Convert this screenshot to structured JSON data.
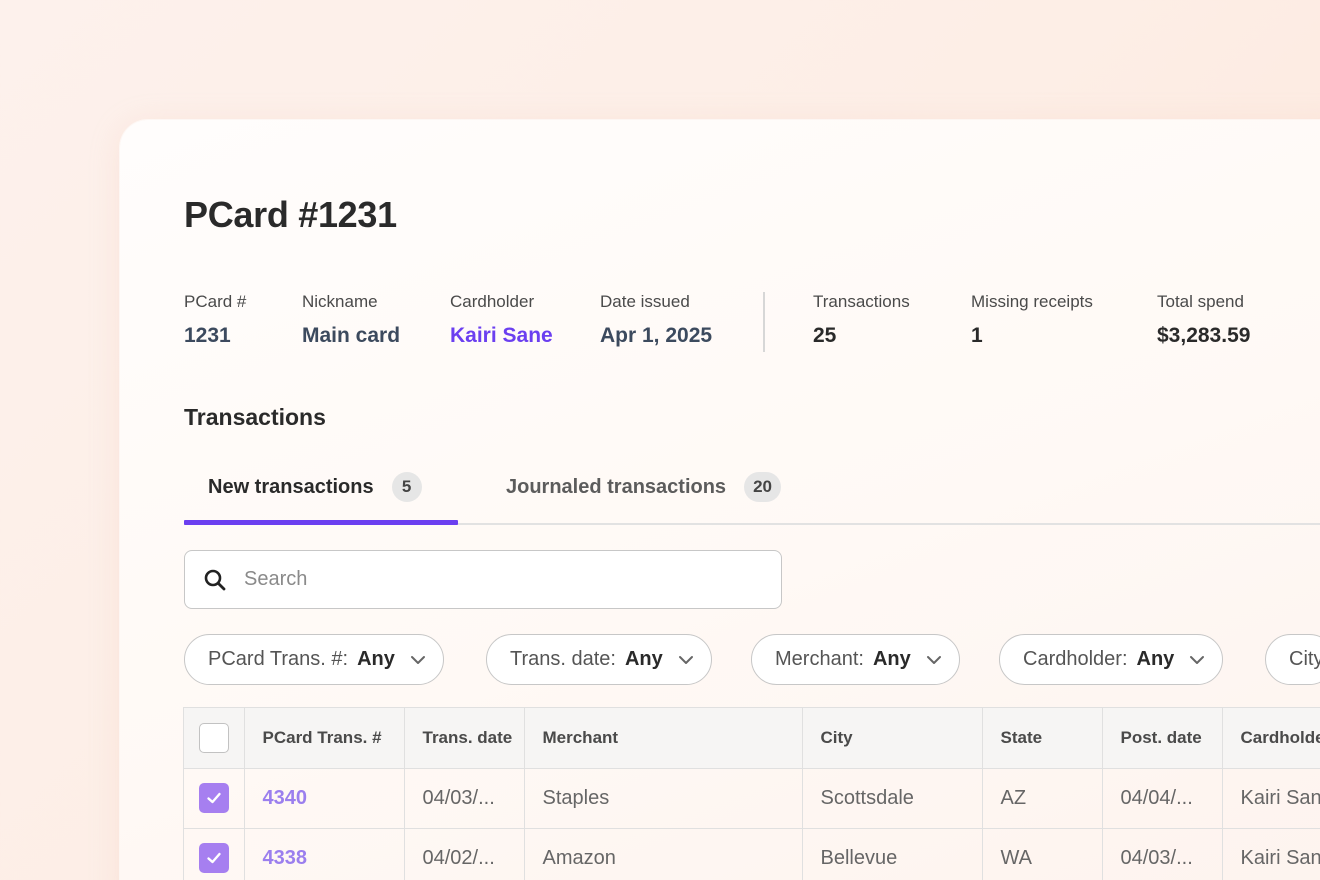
{
  "page": {
    "title": "PCard #1231"
  },
  "meta": [
    {
      "label": "PCard #",
      "value": "1231"
    },
    {
      "label": "Nickname",
      "value": "Main card"
    },
    {
      "label": "Cardholder",
      "value": "Kairi Sane"
    },
    {
      "label": "Date issued",
      "value": "Apr 1, 2025"
    },
    {
      "label": "Transactions",
      "value": "25"
    },
    {
      "label": "Missing receipts",
      "value": "1"
    },
    {
      "label": "Total spend",
      "value": "$3,283.59"
    }
  ],
  "section": {
    "title": "Transactions"
  },
  "tabs": [
    {
      "label": "New transactions",
      "count": "5",
      "active": true
    },
    {
      "label": "Journaled transactions",
      "count": "20",
      "active": false
    }
  ],
  "search": {
    "placeholder": "Search",
    "value": ""
  },
  "filters": [
    {
      "label": "PCard Trans. #:",
      "value": "Any"
    },
    {
      "label": "Trans. date:",
      "value": "Any"
    },
    {
      "label": "Merchant:",
      "value": "Any"
    },
    {
      "label": "Cardholder:",
      "value": "Any"
    },
    {
      "label": "City",
      "value": ""
    }
  ],
  "table": {
    "columns": [
      "PCard Trans. #",
      "Trans. date",
      "Merchant",
      "City",
      "State",
      "Post. date",
      "Cardholder"
    ],
    "rows": [
      {
        "checked": true,
        "cells": [
          "4340",
          "04/03/...",
          "Staples",
          "Scottsdale",
          "AZ",
          "04/04/...",
          "Kairi Sane"
        ]
      },
      {
        "checked": true,
        "cells": [
          "4338",
          "04/02/...",
          "Amazon",
          "Bellevue",
          "WA",
          "04/03/...",
          "Kairi Sane"
        ]
      }
    ]
  },
  "colors": {
    "accent": "#6b3ff0",
    "checkbox_checked": "#a67ff0",
    "link_number": "#9b7fee"
  },
  "icons": [
    "search-icon",
    "chevron-down-icon",
    "checkmark-icon"
  ]
}
